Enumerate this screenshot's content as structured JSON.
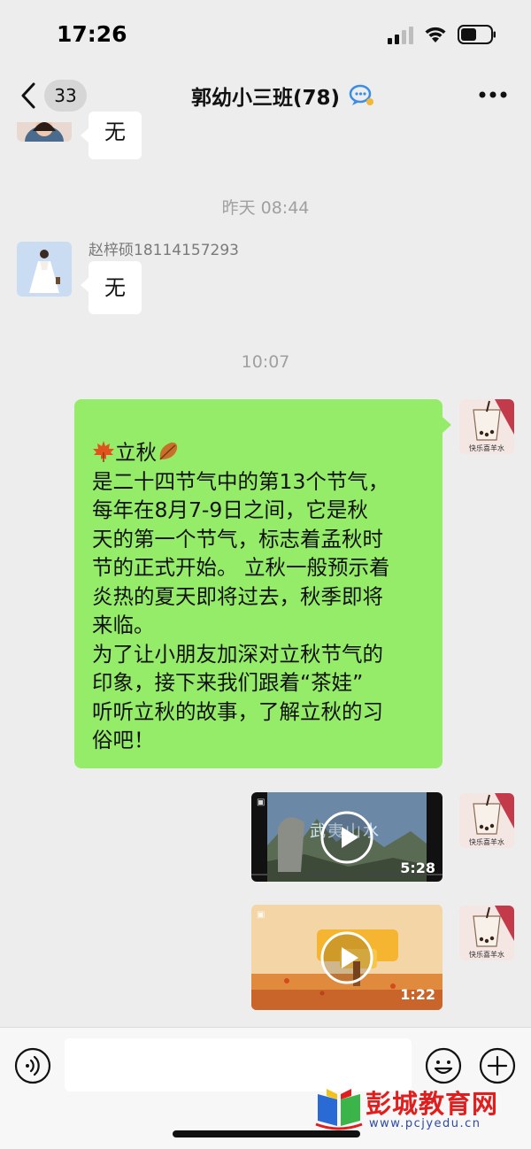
{
  "status_bar": {
    "time": "17:26"
  },
  "nav": {
    "unread_count": "33",
    "title": "郭幼小三班(78)"
  },
  "messages": {
    "partial_reply": "无",
    "timestamp_1": "昨天 08:44",
    "sender_name": "赵梓硕18114157293",
    "reply": "无",
    "timestamp_2": "10:07",
    "green_bubble": {
      "heading": "立秋",
      "lines": [
        "是二十四节气中的第13个节气，",
        "每年在8月7-9日之间，它是秋",
        "天的第一个节气，标志着孟秋时",
        "节的正式开始。 立秋一般预示着",
        "炎热的夏天即将过去，秋季即将",
        "来临。",
        "为了让小朋友加深对立秋节气的",
        "印象，接下来我们跟着“茶娃”",
        "听听立秋的故事，了解立秋的习",
        "俗吧！"
      ]
    },
    "avatar_caption": "快乐喜羊水",
    "video_1": {
      "duration": "5:28",
      "overlay_text": "武夷山水"
    },
    "video_2": {
      "duration": "1:22"
    }
  },
  "watermark": {
    "title": "彭城教育网",
    "url": "www.pcjyedu.cn"
  },
  "colors": {
    "background": "#ededed",
    "bubble_green": "#95ec69",
    "bubble_white": "#ffffff",
    "watermark_red": "#e11e1e",
    "watermark_blue": "#2a4aa8"
  }
}
